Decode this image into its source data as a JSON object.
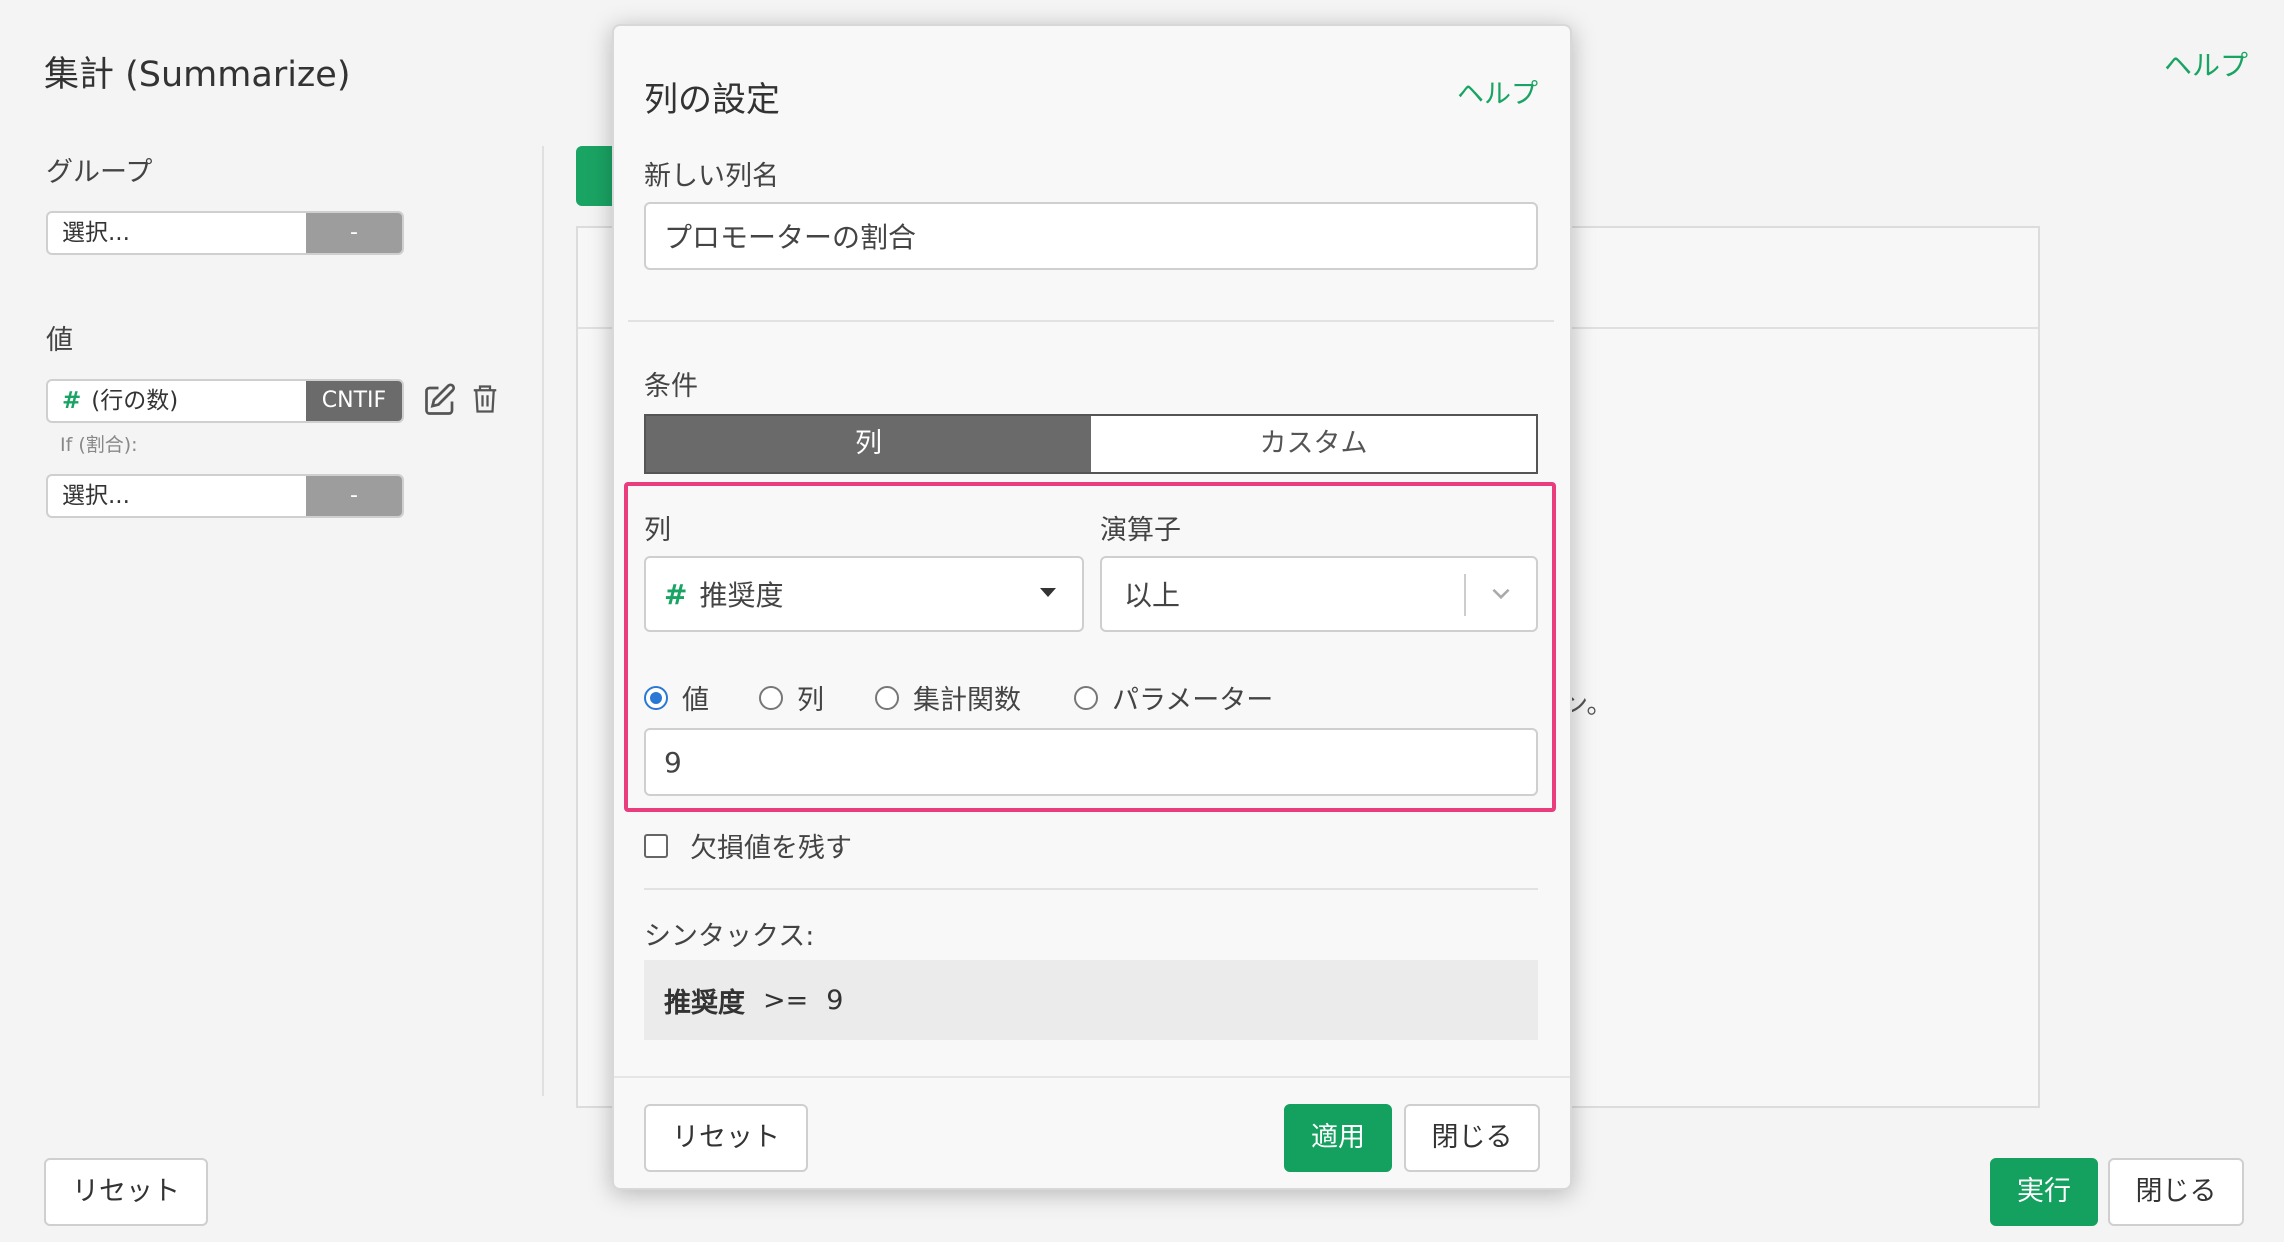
{
  "background": {
    "title": "集計 (Summarize)",
    "help_link": "ヘルプ",
    "group_label": "グループ",
    "group_select": {
      "placeholder": "選択...",
      "button": "-"
    },
    "value_label": "値",
    "value_row": {
      "type_glyph": "#",
      "column": "(行の数)",
      "function": "CNTIF"
    },
    "if_label": "If (割合):",
    "if_select": {
      "placeholder": "選択...",
      "button": "-"
    },
    "partial_text": "ン。",
    "reset_button": "リセット",
    "run_button": "実行",
    "close_button": "閉じる"
  },
  "modal": {
    "title": "列の設定",
    "help_link": "ヘルプ",
    "new_column_label": "新しい列名",
    "new_column_value": "プロモーターの割合",
    "condition_label": "条件",
    "tabs": [
      {
        "label": "列",
        "active": true
      },
      {
        "label": "カスタム",
        "active": false
      }
    ],
    "column_label": "列",
    "column_select": {
      "type_glyph": "#",
      "value": "推奨度"
    },
    "operator_label": "演算子",
    "operator_select": {
      "value": "以上"
    },
    "value_types": [
      {
        "label": "値",
        "selected": true
      },
      {
        "label": "列",
        "selected": false
      },
      {
        "label": "集計関数",
        "selected": false
      },
      {
        "label": "パラメーター",
        "selected": false
      }
    ],
    "value_input": "9",
    "keep_na_label": "欠損値を残す",
    "keep_na_checked": false,
    "syntax_label": "シンタックス:",
    "syntax": {
      "column": "推奨度",
      "operator": ">=",
      "value": "9"
    },
    "reset_button": "リセット",
    "apply_button": "適用",
    "close_button": "閉じる"
  },
  "colors": {
    "accent": "#1aa464",
    "highlight": "#ea3d7d",
    "radio_selected": "#2a78d6"
  }
}
